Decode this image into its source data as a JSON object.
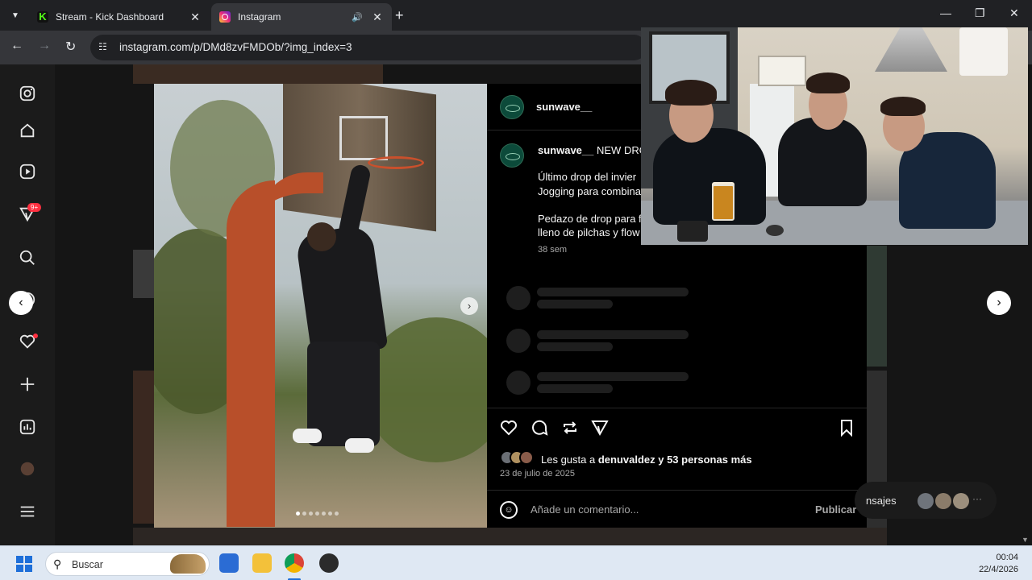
{
  "browser": {
    "tabs": [
      {
        "title": "Stream - Kick Dashboard",
        "favicon": "kick-logo-icon"
      },
      {
        "title": "Instagram",
        "favicon": "instagram-logo-icon",
        "audio": "speaker-icon"
      }
    ],
    "url": "instagram.com/p/DMd8zvFMDOb/?img_index=3"
  },
  "instagram": {
    "notification_badge": "9+",
    "post": {
      "username": "sunwave__",
      "caption_title": "NEW DROP",
      "caption_lines": [
        "Último drop del invier",
        "Jogging para combina",
        "Pedazo de drop para f",
        "lleno de pilchas y flow"
      ],
      "time_ago": "38 sem",
      "likes_prefix": "Les gusta a ",
      "likes_user": "denuvaldez",
      "likes_suffix": " y 53 personas más",
      "date": "23 de julio de 2025",
      "comment_placeholder": "Añade un comentario...",
      "publish_label": "Publicar",
      "image_index": 3,
      "image_count": 7
    },
    "messages_label": "nsajes"
  },
  "taskbar": {
    "search_placeholder": "Buscar",
    "time": "00:04",
    "date": "22/4/2026"
  },
  "colors": {
    "accent": "#0095f6",
    "badge": "#ff3040",
    "kick_green": "#53fc18"
  }
}
